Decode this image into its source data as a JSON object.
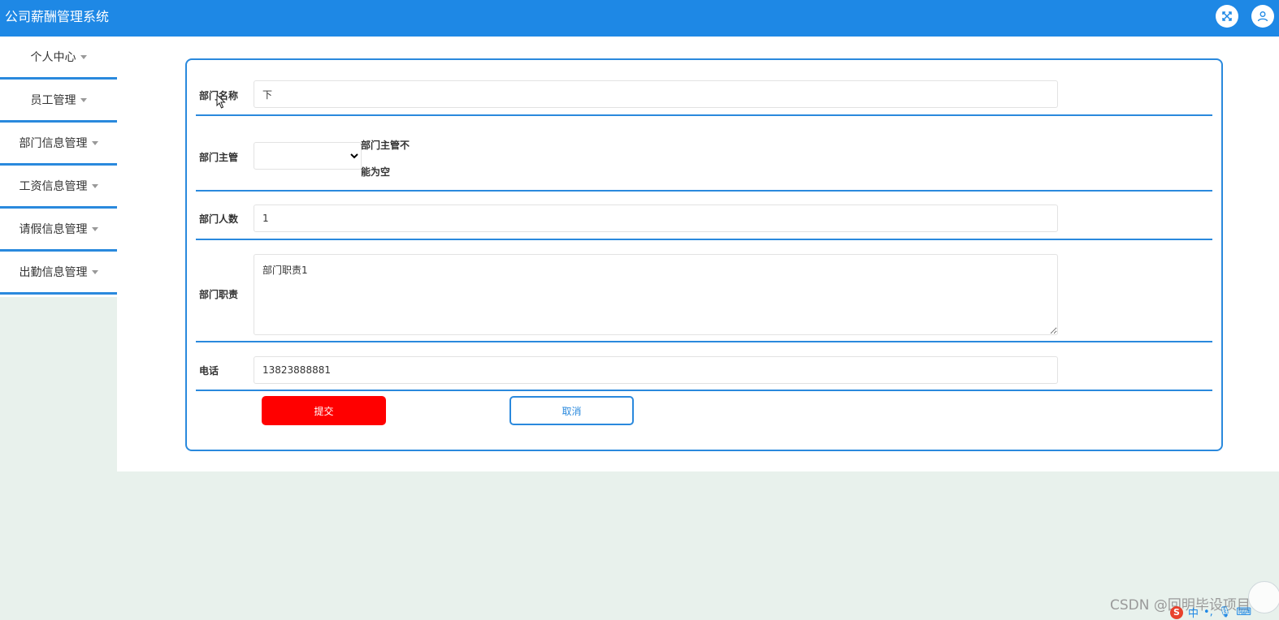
{
  "app": {
    "title": "公司薪酬管理系统"
  },
  "header": {
    "fullscreen_icon": "fullscreen-icon",
    "user_icon": "user-icon",
    "background_color": "#1e88e5"
  },
  "sidebar": {
    "items": [
      {
        "label": "个人中心"
      },
      {
        "label": "员工管理"
      },
      {
        "label": "部门信息管理"
      },
      {
        "label": "工资信息管理"
      },
      {
        "label": "请假信息管理"
      },
      {
        "label": "出勤信息管理"
      }
    ]
  },
  "form": {
    "dept_name": {
      "label": "部门名称",
      "value": "下"
    },
    "dept_manager": {
      "label": "部门主管",
      "value": "",
      "error_line1": "部门主管不",
      "error_line2": "能为空"
    },
    "dept_count": {
      "label": "部门人数",
      "value": "1"
    },
    "dept_duty": {
      "label": "部门职责",
      "value": "部门职责1"
    },
    "phone": {
      "label": "电话",
      "value": "13823888881"
    },
    "submit_label": "提交",
    "cancel_label": "取消"
  },
  "colors": {
    "accent": "#2a89dd",
    "submit": "#ff0000",
    "page_background": "#e8f1ec"
  },
  "watermark": {
    "text": "CSDN @回明毕设项目"
  },
  "ime": {
    "logo": "S",
    "mode": "中"
  }
}
